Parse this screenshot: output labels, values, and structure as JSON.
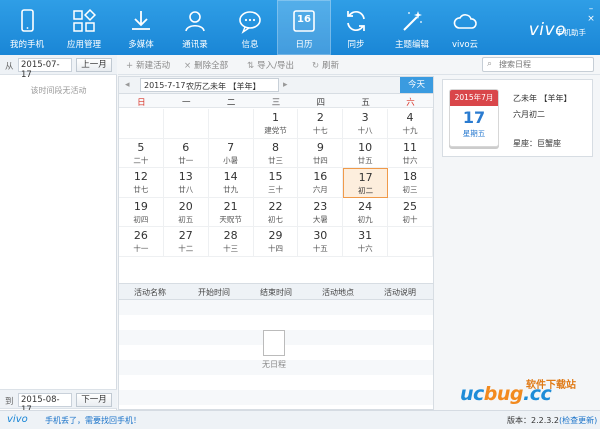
{
  "nav": {
    "items": [
      {
        "label": "我的手机",
        "icon": "phone-icon"
      },
      {
        "label": "应用管理",
        "icon": "apps-icon"
      },
      {
        "label": "多媒体",
        "icon": "download-icon"
      },
      {
        "label": "通讯录",
        "icon": "contacts-icon"
      },
      {
        "label": "信息",
        "icon": "message-icon"
      },
      {
        "label": "日历",
        "icon": "calendar-icon",
        "badge": "16"
      },
      {
        "label": "同步",
        "icon": "sync-icon"
      },
      {
        "label": "主题编辑",
        "icon": "magic-wand-icon"
      },
      {
        "label": "vivo云",
        "icon": "cloud-icon"
      }
    ],
    "brand": "vivo",
    "brand_sub": "手机助手"
  },
  "left": {
    "from_prefix": "从",
    "from_date": "2015-07-17",
    "prev_month": "上一月",
    "empty_text": "该时间段无活动",
    "to_prefix": "到",
    "to_date": "2015-08-17",
    "next_month": "下一月"
  },
  "toolbar": {
    "new": "新建活动",
    "delete_all": "删除全部",
    "import_export": "导入/导出",
    "refresh": "刷新",
    "search_placeholder": "搜索日程"
  },
  "calendar": {
    "header_date": "2015-7-17",
    "header_lunar": "农历乙未年 【羊年】",
    "today": "今天",
    "weekdays": [
      "日",
      "一",
      "二",
      "三",
      "四",
      "五",
      "六"
    ],
    "rows": [
      [
        null,
        null,
        null,
        {
          "d": "1",
          "l": "建党节"
        },
        {
          "d": "2",
          "l": "十七"
        },
        {
          "d": "3",
          "l": "十八"
        },
        {
          "d": "4",
          "l": "十九"
        }
      ],
      [
        {
          "d": "5",
          "l": "二十"
        },
        {
          "d": "6",
          "l": "廿一"
        },
        {
          "d": "7",
          "l": "小暑"
        },
        {
          "d": "8",
          "l": "廿三"
        },
        {
          "d": "9",
          "l": "廿四"
        },
        {
          "d": "10",
          "l": "廿五"
        },
        {
          "d": "11",
          "l": "廿六"
        }
      ],
      [
        {
          "d": "12",
          "l": "廿七"
        },
        {
          "d": "13",
          "l": "廿八"
        },
        {
          "d": "14",
          "l": "廿九"
        },
        {
          "d": "15",
          "l": "三十"
        },
        {
          "d": "16",
          "l": "六月"
        },
        {
          "d": "17",
          "l": "初二",
          "selected": true
        },
        {
          "d": "18",
          "l": "初三"
        }
      ],
      [
        {
          "d": "19",
          "l": "初四"
        },
        {
          "d": "20",
          "l": "初五"
        },
        {
          "d": "21",
          "l": "天贶节"
        },
        {
          "d": "22",
          "l": "初七"
        },
        {
          "d": "23",
          "l": "大暑"
        },
        {
          "d": "24",
          "l": "初九"
        },
        {
          "d": "25",
          "l": "初十"
        }
      ],
      [
        {
          "d": "26",
          "l": "十一"
        },
        {
          "d": "27",
          "l": "十二"
        },
        {
          "d": "28",
          "l": "十三"
        },
        {
          "d": "29",
          "l": "十四"
        },
        {
          "d": "30",
          "l": "十五"
        },
        {
          "d": "31",
          "l": "十六"
        },
        null
      ]
    ]
  },
  "events": {
    "columns": [
      "活动名称",
      "开始时间",
      "结束时间",
      "活动地点",
      "活动说明"
    ],
    "empty": "无日程"
  },
  "detail": {
    "icon_month": "2015年7月",
    "icon_day": "17",
    "icon_weekday": "星期五",
    "ganzhi": "乙未年 【羊年】",
    "lunar_date": "六月初二",
    "constellation": "星座：巨蟹座"
  },
  "status": {
    "logo": "vivo",
    "lost_phone": "手机丢了，需要找回手机！",
    "version_label": "版本：",
    "version": "2.2.3.2",
    "check_update": "(检查更新)"
  },
  "watermark": {
    "brand_a": "uc",
    "brand_b": "bug",
    "brand_c": ".cc",
    "sub": "软件下载站"
  }
}
